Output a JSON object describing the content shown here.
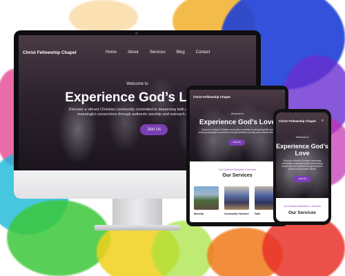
{
  "site": {
    "brand": "Christ Fellowship Chapel",
    "nav": [
      "Home",
      "About",
      "Services",
      "Blog",
      "Contact"
    ],
    "welcome": "Welcome to",
    "hero_title": "Experience God’s Love",
    "hero_subtitle": "Discover a vibrant Christian community committed to deepening faith and building meaningful connections through authentic worship and outreach efforts.",
    "cta": "Join Us",
    "services_kicker": "Our Featured Ministries & Services",
    "services_title": "Our Services",
    "services": [
      "Worship",
      "Community Outreach",
      "Faith"
    ]
  },
  "colors": {
    "accent": "#7b3fb5",
    "kicker": "#8a4bc4"
  },
  "icons": {
    "menu": "hamburger-icon"
  }
}
